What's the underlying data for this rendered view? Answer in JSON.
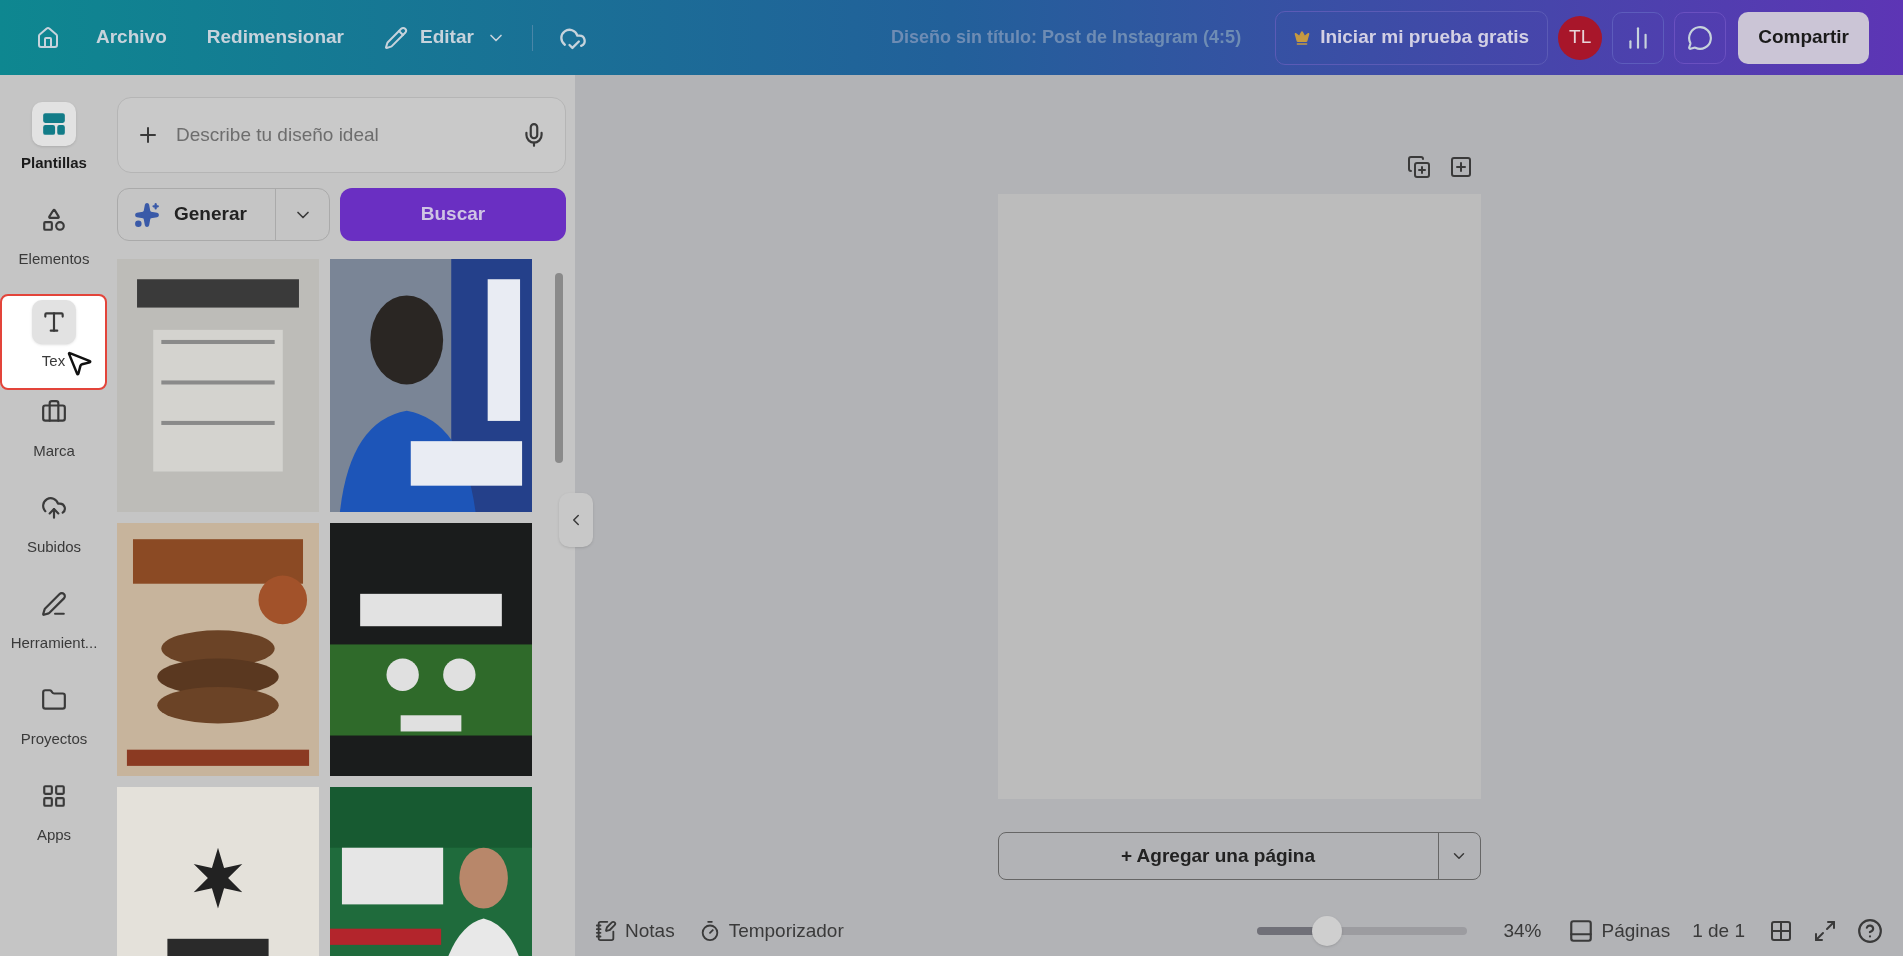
{
  "topbar": {
    "menu": [
      {
        "label": "Archivo",
        "kind": "text"
      },
      {
        "label": "Redimensionar",
        "kind": "text"
      },
      {
        "label": "Editar",
        "kind": "edit"
      }
    ],
    "title": "Diseño sin título: Post de Instagram (4:5)",
    "trial": "Iniciar mi prueba gratis",
    "avatar": "TL",
    "share": "Compartir"
  },
  "rail": [
    {
      "label": "Plantillas",
      "kind": "templates",
      "selected": true,
      "focused": false
    },
    {
      "label": "Elementos",
      "kind": "elements",
      "selected": false,
      "focused": false
    },
    {
      "label": "Tex",
      "kind": "text",
      "selected": false,
      "focused": true
    },
    {
      "label": "Marca",
      "kind": "brand",
      "selected": false,
      "focused": false
    },
    {
      "label": "Subidos",
      "kind": "uploads",
      "selected": false,
      "focused": false
    },
    {
      "label": "Herramient...",
      "kind": "tools",
      "selected": false,
      "focused": false
    },
    {
      "label": "Proyectos",
      "kind": "projects",
      "selected": false,
      "focused": false
    },
    {
      "label": "Apps",
      "kind": "apps",
      "selected": false,
      "focused": false
    }
  ],
  "panel": {
    "prompt": {
      "placeholder": "Describe tu diseño ideal"
    },
    "generate": "Generar",
    "search": "Buscar"
  },
  "canvas": {
    "add_page": "+ Agregar una página"
  },
  "footer": {
    "notes": "Notas",
    "timer": "Temporizador",
    "zoom": {
      "level": 0.33,
      "reading": "34%"
    },
    "pages": "Páginas",
    "page_count": "1 de 1"
  }
}
